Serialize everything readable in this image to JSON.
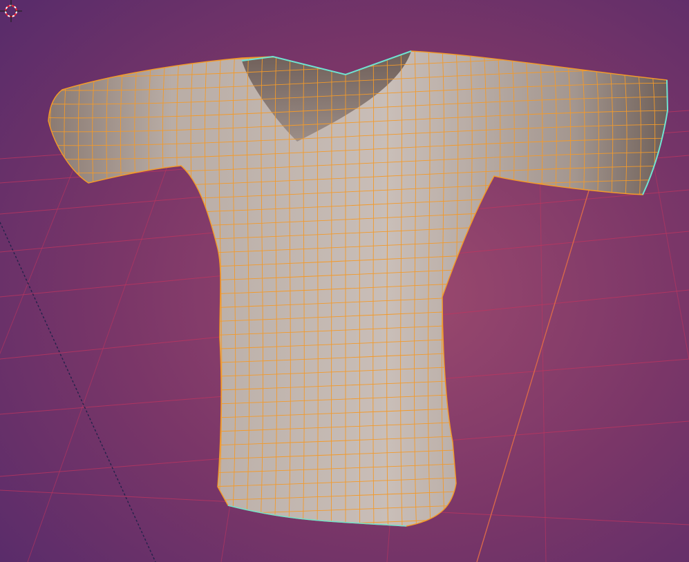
{
  "viewport": {
    "label": "",
    "background_top": "#5b2c6a",
    "background_mid": "#8a3a6a",
    "background_bottom": "#5a2c6a",
    "floor_grid_color": "#c0355f",
    "axis_y_color": "#d8684a",
    "axis_x_color": "#22224a"
  },
  "object": {
    "name_visible": false,
    "mesh_color": "#b6aaa3",
    "wire_color": "#f39a2a",
    "seam_color": "#6fe3d2"
  },
  "cursor": {
    "icon": "3d-cursor-icon"
  }
}
